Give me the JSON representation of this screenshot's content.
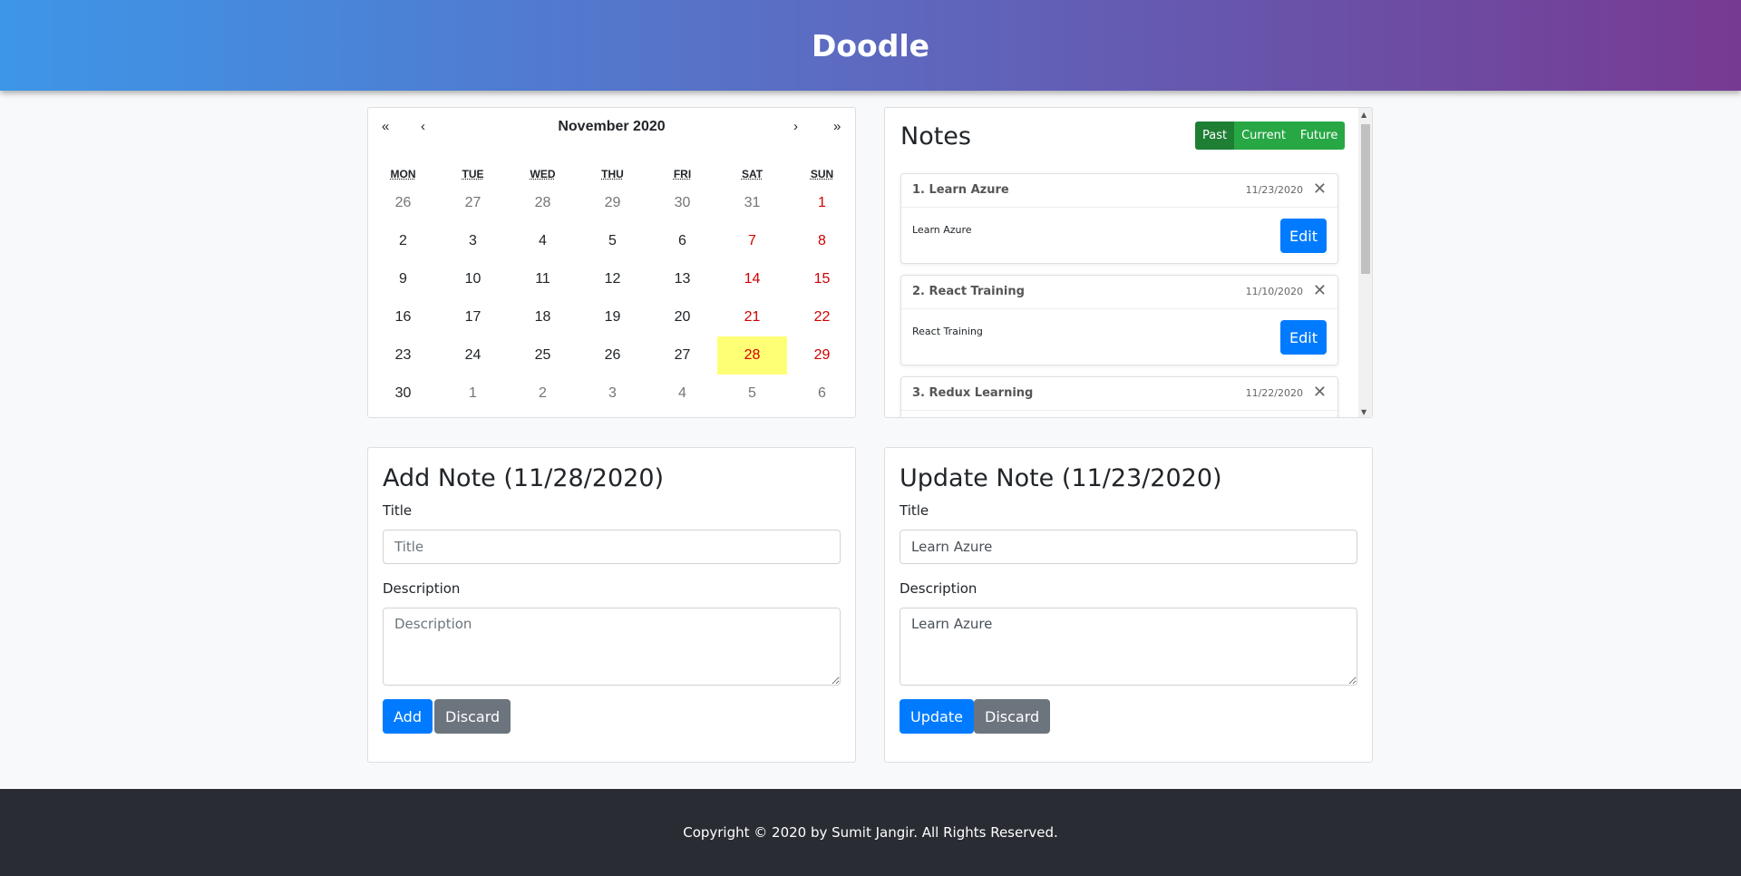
{
  "header": {
    "title": "Doodle"
  },
  "calendar": {
    "nav": {
      "prev_year": "«",
      "prev_month": "‹",
      "next_month": "›",
      "next_year": "»"
    },
    "month_label": "November 2020",
    "weekdays": [
      "MON",
      "TUE",
      "WED",
      "THU",
      "FRI",
      "SAT",
      "SUN"
    ],
    "selected_day": "28",
    "days": [
      [
        "26",
        "27",
        "28",
        "29",
        "30",
        "31",
        "1"
      ],
      [
        "2",
        "3",
        "4",
        "5",
        "6",
        "7",
        "8"
      ],
      [
        "9",
        "10",
        "11",
        "12",
        "13",
        "14",
        "15"
      ],
      [
        "16",
        "17",
        "18",
        "19",
        "20",
        "21",
        "22"
      ],
      [
        "23",
        "24",
        "25",
        "26",
        "27",
        "28",
        "29"
      ],
      [
        "30",
        "1",
        "2",
        "3",
        "4",
        "5",
        "6"
      ]
    ]
  },
  "notes": {
    "title": "Notes",
    "filters": [
      "Past",
      "Current",
      "Future"
    ],
    "active_filter": "Past",
    "items": [
      {
        "title": "1. Learn Azure",
        "date": "11/23/2020",
        "description": "Learn Azure",
        "edit": "Edit",
        "close": "✕"
      },
      {
        "title": "2. React Training",
        "date": "11/10/2020",
        "description": "React Training",
        "edit": "Edit",
        "close": "✕"
      },
      {
        "title": "3. Redux Learning",
        "date": "11/22/2020",
        "close": "✕"
      }
    ]
  },
  "add_note": {
    "heading": "Add Note (11/28/2020)",
    "title_label": "Title",
    "title_placeholder": "Title",
    "title_value": "",
    "desc_label": "Description",
    "desc_placeholder": "Description",
    "desc_value": "",
    "submit": "Add",
    "discard": "Discard"
  },
  "update_note": {
    "heading": "Update Note (11/23/2020)",
    "title_label": "Title",
    "title_value": "Learn Azure",
    "desc_label": "Description",
    "desc_value": "Learn Azure",
    "submit": "Update",
    "discard": "Discard"
  },
  "footer": {
    "text": "Copyright © 2020 by Sumit Jangir. All Rights Reserved."
  },
  "colors": {
    "primary": "#007bff",
    "secondary": "#6c757d",
    "success": "#28a745",
    "weekend": "#d10000",
    "selected_day": "#ffff76",
    "footer_bg": "#292c33"
  }
}
